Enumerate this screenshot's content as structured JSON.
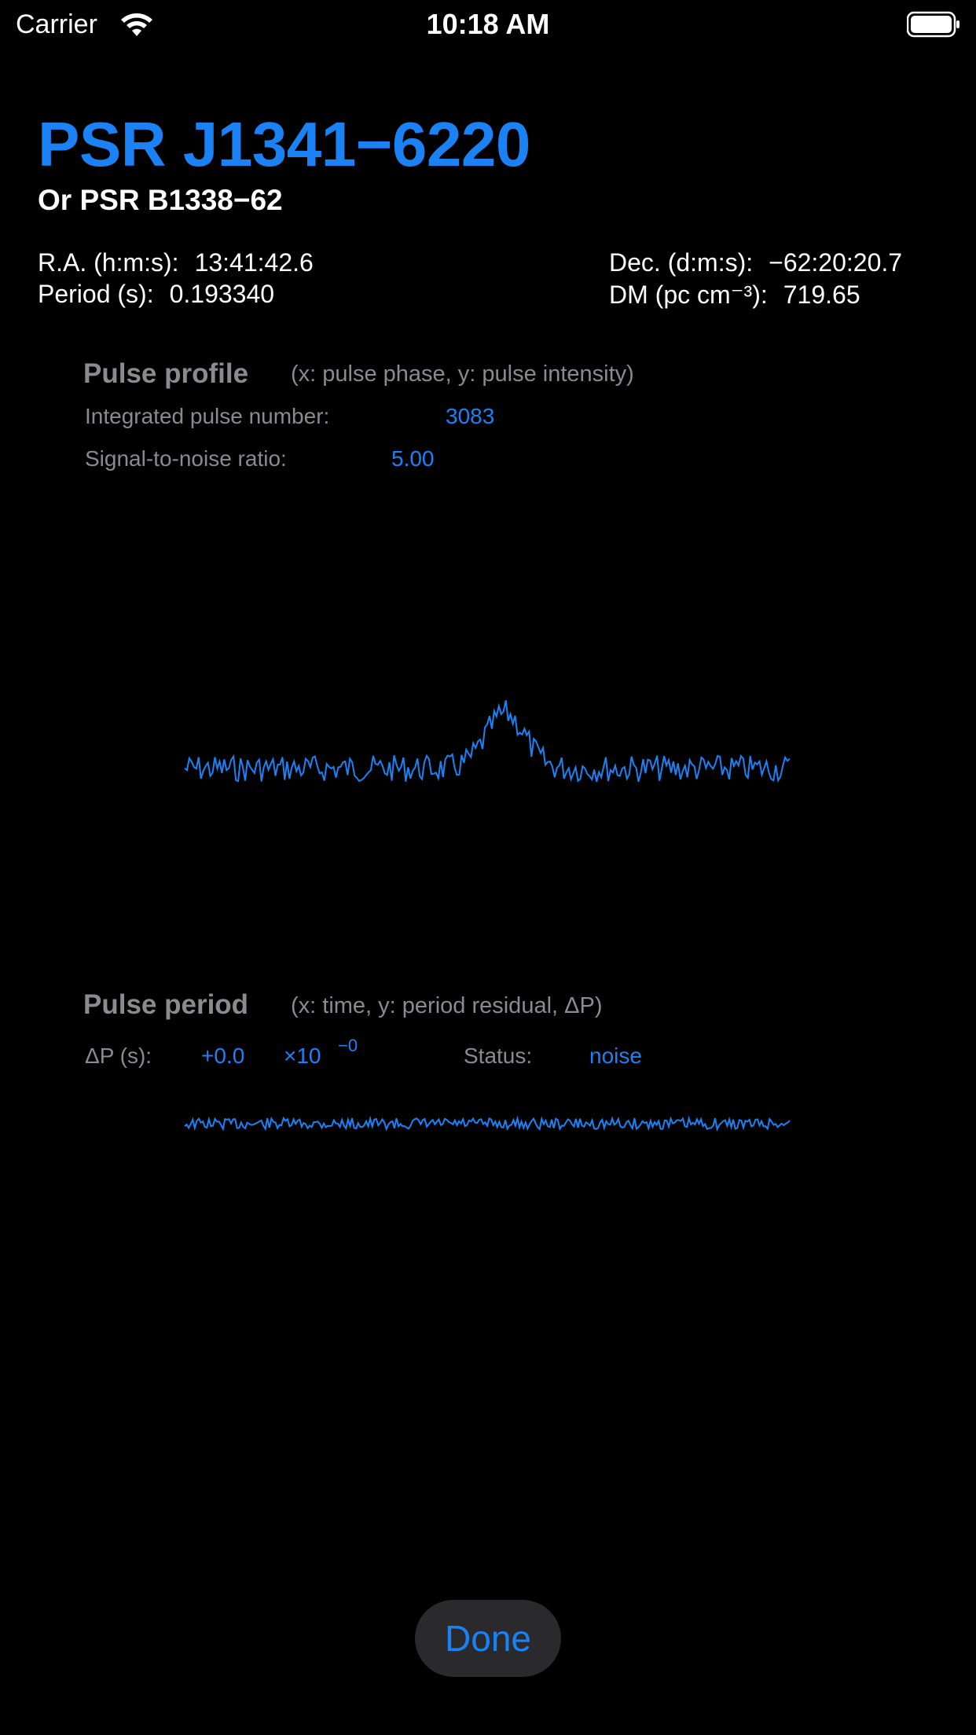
{
  "status_bar": {
    "carrier": "Carrier",
    "time": "10:18 AM"
  },
  "header": {
    "title": "PSR J1341−6220",
    "subtitle": "Or PSR B1338−62"
  },
  "info": {
    "ra_label": "R.A. (h:m:s):",
    "ra_value": "13:41:42.6",
    "period_label": "Period (s):",
    "period_value": "0.193340",
    "dec_label": "Dec. (d:m:s):",
    "dec_value": "−62:20:20.7",
    "dm_label": "DM (pc cm⁻³):",
    "dm_value": "719.65"
  },
  "pulse_profile": {
    "title": "Pulse profile",
    "hint": "(x: pulse phase, y: pulse intensity)",
    "integrated_label": "Integrated pulse number:",
    "integrated_value": "3083",
    "snr_label": "Signal-to-noise ratio:",
    "snr_value": "5.00"
  },
  "pulse_period": {
    "title": "Pulse period",
    "hint": "(x: time, y: period residual, ΔP)",
    "dp_label": "ΔP (s):",
    "dp_value": "+0.0",
    "dp_multiplier": "×10",
    "dp_exponent": "−0",
    "status_label": "Status:",
    "status_value": "noise"
  },
  "done_label": "Done",
  "colors": {
    "accent": "#1a82f5",
    "secondary": "#8a8a8f",
    "background": "#000000"
  }
}
